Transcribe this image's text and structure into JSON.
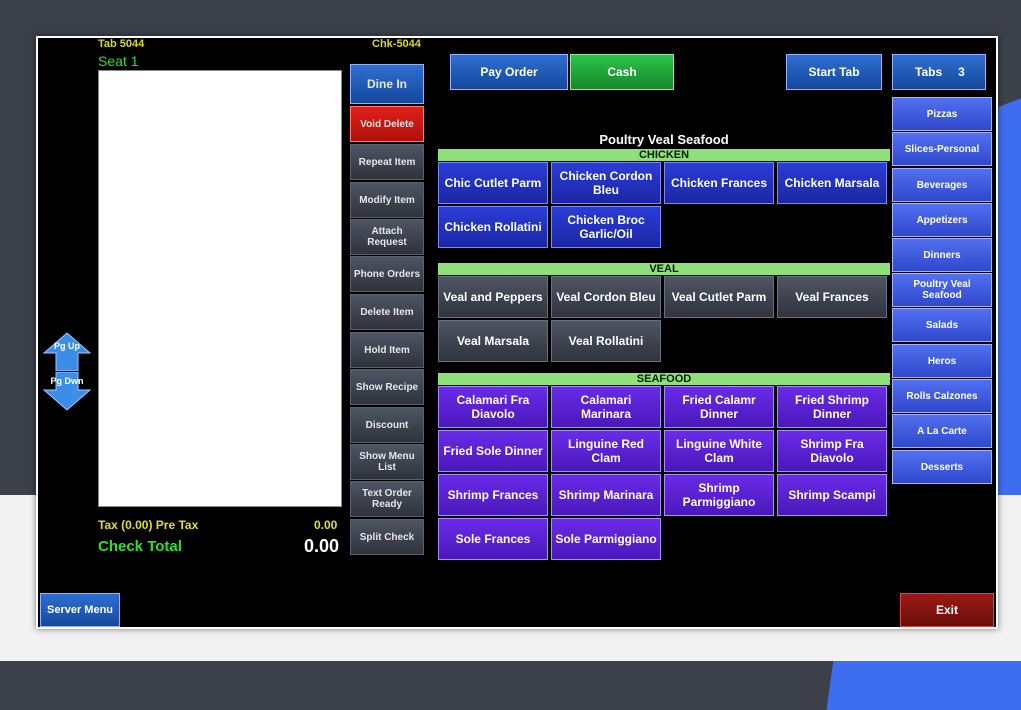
{
  "header": {
    "tab_label": "Tab  5044",
    "check_label": "Chk-5044",
    "seat_label": "Seat 1"
  },
  "order": {
    "tax_label": "Tax (0.00)  Pre Tax",
    "tax_value": "0.00",
    "total_label": "Check Total",
    "total_value": "0.00"
  },
  "side_buttons": [
    {
      "label": "Dine In"
    },
    {
      "label": "Void Delete"
    },
    {
      "label": "Repeat Item"
    },
    {
      "label": "Modify Item"
    },
    {
      "label": "Attach Request"
    },
    {
      "label": "Phone Orders"
    },
    {
      "label": "Delete Item"
    },
    {
      "label": "Hold Item"
    },
    {
      "label": "Show Recipe"
    },
    {
      "label": "Discount"
    },
    {
      "label": "Show Menu List"
    },
    {
      "label": "Text Order Ready"
    },
    {
      "label": "Split Check"
    }
  ],
  "top_buttons": {
    "pay": "Pay Order",
    "cash": "Cash",
    "start_tab": "Start Tab",
    "tabs_label": "Tabs",
    "tabs_count": "3"
  },
  "menu": {
    "title": "Poultry Veal Seafood",
    "sections": [
      {
        "name": "CHICKEN",
        "items": [
          "Chic Cutlet Parm",
          "Chicken Cordon Bleu",
          "Chicken Frances",
          "Chicken Marsala",
          "Chicken Rollatini",
          "Chicken Broc Garlic/Oil"
        ]
      },
      {
        "name": "VEAL",
        "items": [
          "Veal and Peppers",
          "Veal Cordon Bleu",
          "Veal Cutlet Parm",
          "Veal Frances",
          "Veal Marsala",
          "Veal Rollatini"
        ]
      },
      {
        "name": "SEAFOOD",
        "items": [
          "Calamari Fra Diavolo",
          "Calamari Marinara",
          "Fried Calamr Dinner",
          "Fried Shrimp Dinner",
          "Fried Sole Dinner",
          "Linguine Red Clam",
          "Linguine White Clam",
          "Shrimp Fra Diavolo",
          "Shrimp Frances",
          "Shrimp Marinara",
          "Shrimp Parmiggiano",
          "Shrimp Scampi",
          "Sole Frances",
          "Sole Parmiggiano"
        ]
      }
    ]
  },
  "categories": [
    "Pizzas",
    "Slices-Personal",
    "Beverages",
    "Appetizers",
    "Dinners",
    "Poultry Veal Seafood",
    "Salads",
    "Heros",
    "Rolls Calzones",
    "A La Carte",
    "Desserts"
  ],
  "paging": {
    "up": "Pg Up",
    "down": "Pg Dwn"
  },
  "footer": {
    "server_menu": "Server Menu",
    "exit": "Exit"
  }
}
